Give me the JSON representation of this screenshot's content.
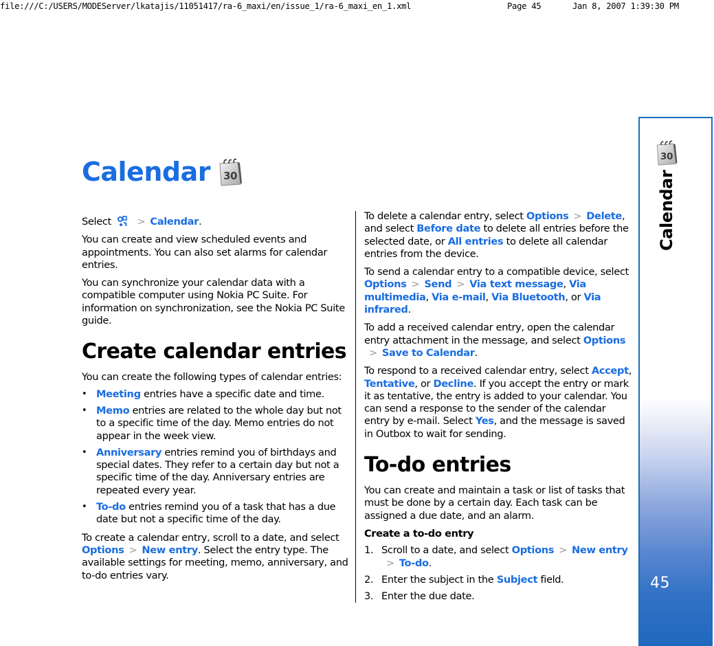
{
  "print_header": {
    "path": "file:///C:/USERS/MODEServer/lkatajis/11051417/ra-6_maxi/en/issue_1/ra-6_maxi_en_1.xml",
    "page": "Page 45",
    "datetime": "Jan 8, 2007 1:39:30 PM"
  },
  "icons": {
    "calendar": "calendar-30-icon",
    "menu": "menu-key-icon",
    "separator": "chevron-right"
  },
  "colors": {
    "link": "#1a6de0",
    "tab_border": "#1e6bbf",
    "tab_bottom": "#1f68bd"
  },
  "title": "Calendar",
  "calendar_icon_number": "30",
  "left": {
    "select_prefix": "Select",
    "select_sep": ">",
    "select_target": "Calendar",
    "select_end": ".",
    "intro": "You can create and view scheduled events and appointments. You can also set alarms for calendar entries.",
    "sync": "You can synchronize your calendar data with a compatible computer using Nokia PC Suite. For information on synchronization, see the Nokia PC Suite guide.",
    "section_title": "Create calendar entries",
    "types_intro": "You can create the following types of calendar entries:",
    "bullets": [
      {
        "term": "Meeting",
        "text": " entries have a specific date and time."
      },
      {
        "term": "Memo",
        "text": " entries are related to the whole day but not to a specific time of the day. Memo entries do not appear in the week view."
      },
      {
        "term": "Anniversary",
        "text": " entries remind you of birthdays and special dates. They refer to a certain day but not a specific time of the day. Anniversary entries are repeated every year."
      },
      {
        "term": "To-do",
        "text": " entries remind you of a task that has a due date but not a specific time of the day."
      }
    ],
    "create": {
      "pre": "To create a calendar entry, scroll to a date, and select ",
      "link1": "Options",
      "sep": ">",
      "link2": "New entry",
      "post": ". Select the entry type. The available settings for meeting, memo, anniversary, and to-do entries vary."
    }
  },
  "right": {
    "delete": {
      "pre": "To delete a calendar entry, select ",
      "options": "Options",
      "sep": ">",
      "delete": "Delete",
      "mid1": ", and select ",
      "before_date": "Before date",
      "mid2": " to delete all entries before the selected date, or ",
      "all_entries": "All entries",
      "post": " to delete all calendar entries from the device."
    },
    "send": {
      "pre": "To send a calendar entry to a compatible device, select ",
      "options": "Options",
      "sep": ">",
      "send": "Send",
      "text_msg": "Via text message",
      "comma1": ", ",
      "multimedia": "Via multimedia",
      "comma2": ", ",
      "email": "Via e-mail",
      "comma3": ", ",
      "bluetooth": "Via Bluetooth",
      "or": ", or ",
      "infrared": "Via infrared",
      "end": "."
    },
    "add": {
      "pre": "To add a received calendar entry, open the calendar entry attachment in the message, and select ",
      "options": "Options",
      "sep": ">",
      "save": "Save to Calendar",
      "end": "."
    },
    "respond": {
      "pre": "To respond to a received calendar entry, select ",
      "accept": "Accept",
      "comma": ", ",
      "tentative": "Tentative",
      "or": ", or ",
      "decline": "Decline",
      "mid": ". If you accept the entry or mark it as tentative, the entry is added to your calendar. You can send a response to the sender of the calendar entry by e-mail. Select ",
      "yes": "Yes",
      "post": ", and the message is saved in Outbox to wait for sending."
    },
    "todo_title": "To-do entries",
    "todo_intro": "You can create and maintain a task or list of tasks that must be done by a certain day. Each task can be assigned a due date, and an alarm.",
    "todo_sub": "Create a to-do entry",
    "steps": [
      {
        "num": "1.",
        "pre": "Scroll to a date, and select ",
        "options": "Options",
        "sep": ">",
        "new_entry": "New entry",
        "todo": "To-do",
        "end": "."
      },
      {
        "num": "2.",
        "pre": "Enter the subject in the ",
        "subject": "Subject",
        "post": " field."
      },
      {
        "num": "3.",
        "text": "Enter the due date."
      }
    ]
  },
  "side_tab": {
    "label": "Calendar",
    "page_number": "45"
  }
}
